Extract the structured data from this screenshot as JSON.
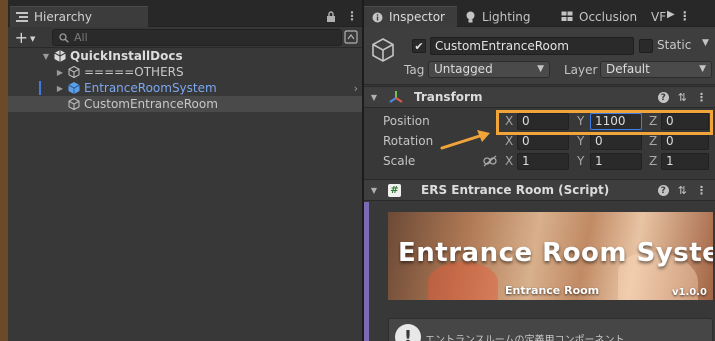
{
  "hierarchy": {
    "tab_label": "Hierarchy",
    "add_label": "+",
    "search_placeholder": "All",
    "scene_name": "QuickInstallDocs",
    "items": [
      {
        "label": "=====OTHERS"
      },
      {
        "label": "EntranceRoomSystem"
      },
      {
        "label": "CustomEntranceRoom"
      }
    ]
  },
  "inspector": {
    "tabs": [
      "Inspector",
      "Lighting",
      "Occlusion",
      "VF"
    ],
    "object": {
      "name": "CustomEntranceRoom",
      "active": true,
      "static_label": "Static",
      "tag_label": "Tag",
      "tag_value": "Untagged",
      "layer_label": "Layer",
      "layer_value": "Default"
    },
    "transform": {
      "title": "Transform",
      "position_label": "Position",
      "rotation_label": "Rotation",
      "scale_label": "Scale",
      "axis_x": "X",
      "axis_y": "Y",
      "axis_z": "Z",
      "position": {
        "x": "0",
        "y": "1100",
        "z": "0"
      },
      "rotation": {
        "x": "0",
        "y": "0",
        "z": "0"
      },
      "scale": {
        "x": "1",
        "y": "1",
        "z": "1"
      }
    },
    "script_component": {
      "title": "ERS Entrance Room (Script)",
      "banner_title": "Entrance Room System",
      "banner_subtitle": "Entrance Room",
      "banner_version": "v1.0.0",
      "help_text": "エントランスルームの定義用コンポーネント"
    }
  },
  "colors": {
    "highlight": "#f0a43a",
    "selected_text": "#7ca8f0",
    "script_bar": "#7d6ab5"
  }
}
